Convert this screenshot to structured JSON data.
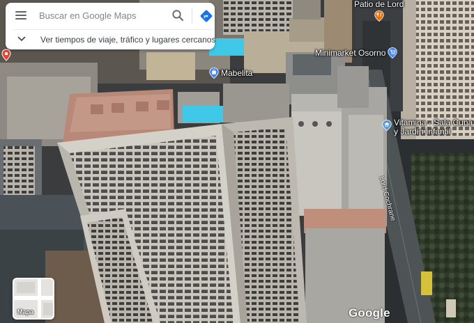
{
  "search": {
    "placeholder": "Buscar en Google Maps",
    "explore_label": "Ver tiempos de viaje, tráfico y lugares cercanos"
  },
  "map": {
    "view": "satellite-3d",
    "pois": [
      {
        "name": "Patio de Lord",
        "icon": "restaurant-pin-icon",
        "color": "#e8710a"
      },
      {
        "name": "Minimarket Osorno",
        "icon": "shopping-cart-pin-icon",
        "color": "#4285f4"
      },
      {
        "name": "Mabelita",
        "icon": "shopping-bag-pin-icon",
        "color": "#4285f4"
      },
      {
        "name": "Vitamina - Sala Cuna",
        "name_line2": "y Jardín Infantil",
        "icon": "school-pin-icon",
        "color": "#5c9ad6"
      }
    ],
    "street_label": "Lord Cochrane",
    "attribution": "Google"
  },
  "layer_toggle": {
    "label": "Mapa"
  },
  "colors": {
    "accent": "#1a73e8",
    "directions": "#1a73e8",
    "pool": "#3fc8e8"
  }
}
